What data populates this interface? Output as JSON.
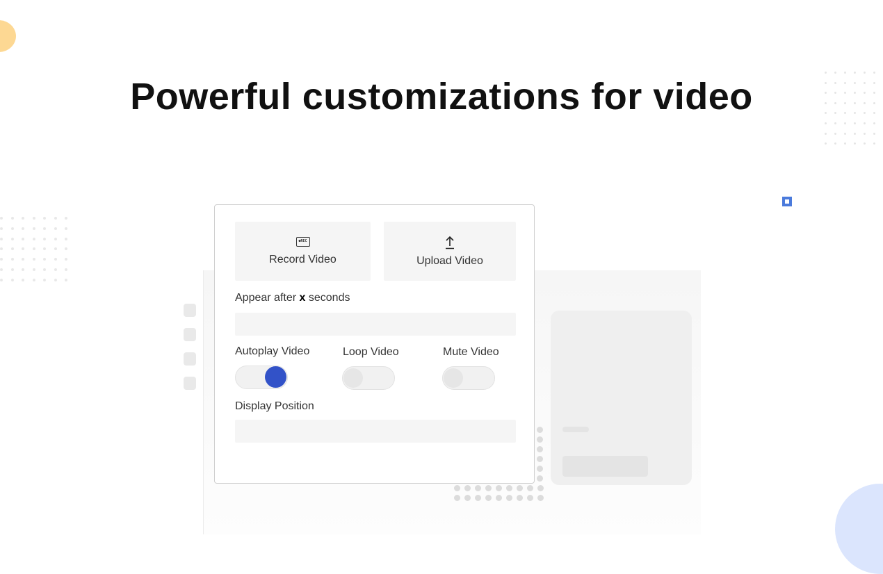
{
  "headline": "Powerful customizations for video",
  "settings": {
    "record_button": {
      "label": "Record Video",
      "icon": "rec-icon",
      "icon_text": "●REC"
    },
    "upload_button": {
      "label": "Upload Video",
      "icon": "upload-arrow-icon"
    },
    "appear_after": {
      "label_prefix": "Appear after",
      "label_var": "x",
      "label_suffix": "seconds",
      "value": ""
    },
    "autoplay": {
      "label": "Autoplay Video",
      "on": true
    },
    "loop": {
      "label": "Loop Video",
      "on": false
    },
    "mute": {
      "label": "Mute Video",
      "on": false
    },
    "display_position": {
      "label": "Display Position",
      "value": ""
    }
  },
  "colors": {
    "accent": "#3252c8",
    "decor_yellow": "#fdd893",
    "decor_blue": "#dbe5fd",
    "marker_blue": "#4b7bdc"
  }
}
